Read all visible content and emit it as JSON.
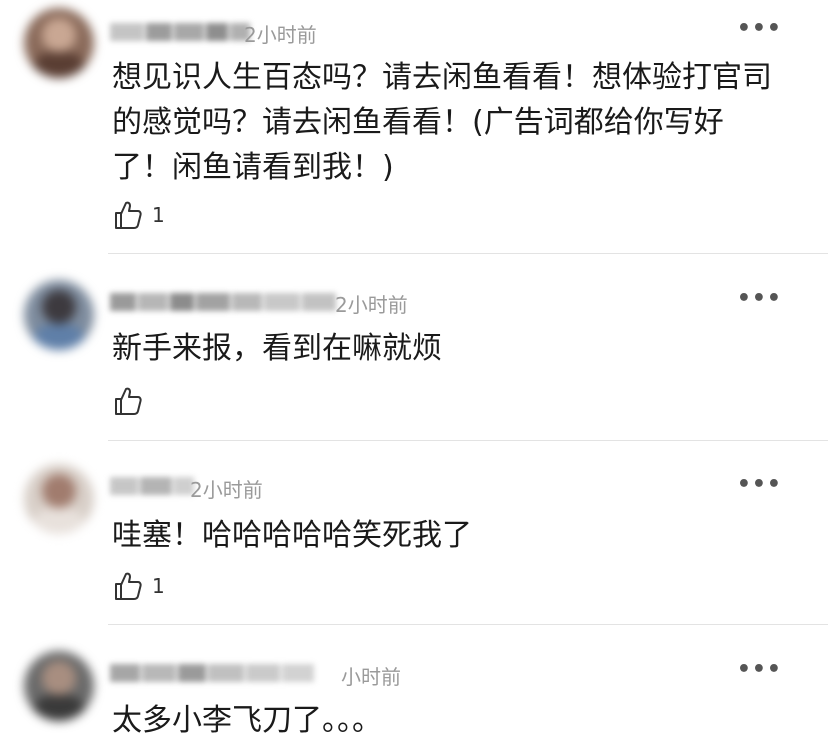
{
  "more_label": "•••",
  "like_icon": "thumbs-up-icon",
  "comments": [
    {
      "time": "2小时前",
      "text": "想见识人生百态吗？请去闲鱼看看！想体验打官司的感觉吗？请去闲鱼看看！(广告词都给你写好了！闲鱼请看到我！)",
      "likes": "1"
    },
    {
      "time": "2小时前",
      "text": "新手来报，看到在嘛就烦",
      "likes": ""
    },
    {
      "time": "2小时前",
      "text": "哇塞！哈哈哈哈哈笑死我了",
      "likes": "1"
    },
    {
      "time": "小时前",
      "text": "太多小李飞刀了。。。",
      "likes": ""
    }
  ]
}
